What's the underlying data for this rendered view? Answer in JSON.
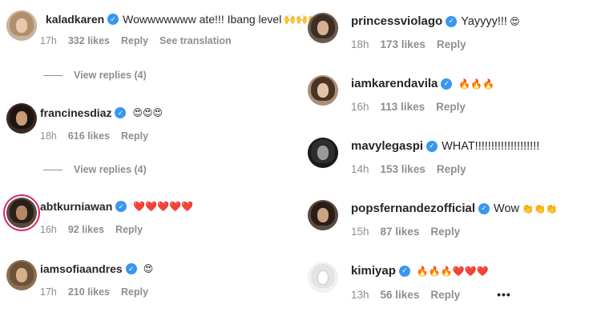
{
  "left": [
    {
      "username": "kaladkaren",
      "text": "Wowwwwwww ate!!! Ibang level",
      "emoji": "🙌🙌🙌",
      "time": "17h",
      "likes": "332 likes",
      "reply": "Reply",
      "translate": "See translation",
      "view_replies": "View replies (4)"
    },
    {
      "username": "francinesdiaz",
      "text": "",
      "emoji": "😍😍😍",
      "time": "18h",
      "likes": "616 likes",
      "reply": "Reply",
      "view_replies": "View replies (4)"
    },
    {
      "username": "abtkurniawan",
      "text": "",
      "emoji": "❤️❤️❤️❤️❤️",
      "time": "16h",
      "likes": "92 likes",
      "reply": "Reply"
    },
    {
      "username": "iamsofiaandres",
      "text": "",
      "emoji": "😍",
      "time": "17h",
      "likes": "210 likes",
      "reply": "Reply"
    }
  ],
  "right": [
    {
      "username": "princessviolago",
      "text": "Yayyyy!!!",
      "emoji": "😍",
      "time": "18h",
      "likes": "173 likes",
      "reply": "Reply"
    },
    {
      "username": "iamkarendavila",
      "text": "",
      "emoji": "🔥🔥🔥",
      "time": "16h",
      "likes": "113 likes",
      "reply": "Reply"
    },
    {
      "username": "mavylegaspi",
      "text": "WHAT!!!!!!!!!!!!!!!!!!!!",
      "emoji": "",
      "time": "14h",
      "likes": "153 likes",
      "reply": "Reply"
    },
    {
      "username": "popsfernandezofficial",
      "text": "Wow",
      "emoji": "👏👏👏",
      "time": "15h",
      "likes": "87 likes",
      "reply": "Reply"
    },
    {
      "username": "kimiyap",
      "text": "",
      "emoji": "🔥🔥🔥❤️❤️❤️",
      "time": "13h",
      "likes": "56 likes",
      "reply": "Reply",
      "more": "•••"
    }
  ],
  "colors": {
    "text": "#262626",
    "meta": "#8e8e8e",
    "verified": "#3897f0",
    "story_ring": "#d62976"
  }
}
